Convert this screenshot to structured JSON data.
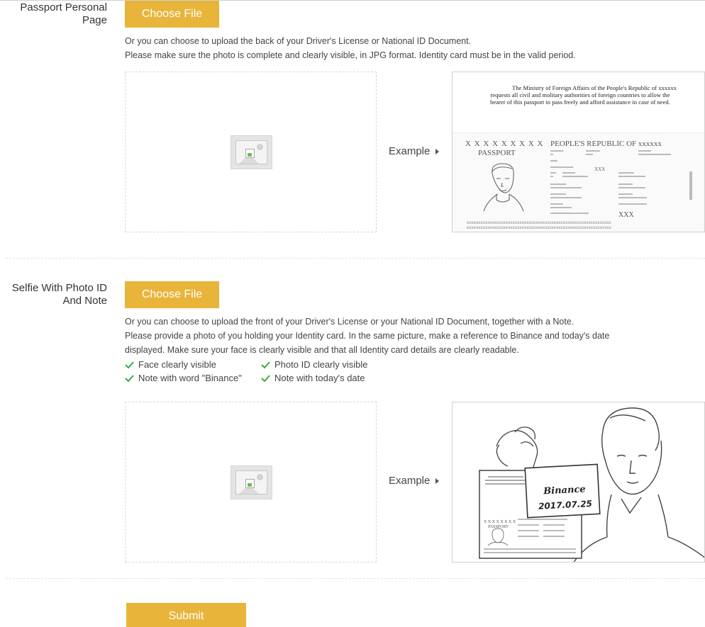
{
  "passport": {
    "label_line1": "Passport Personal",
    "label_line2": "Page",
    "choose_label": "Choose File",
    "hint_line1": "Or you can choose to upload the back of your Driver's License or National ID Document.",
    "hint_line2": "Please make sure the photo is complete and clearly visible, in JPG format. Identity card must be in the valid period.",
    "example_label": "Example",
    "sample": {
      "ministry_line1": "The Ministry of Foreign Affairs of the People's Republic of xxxxxx",
      "ministry_line2": "requests all civil and molitary authorities of foreign countries to allow the",
      "ministry_line3": "bearer of  this passport to pass freely and afford assistance in case of need.",
      "code_row": "X X X X X X X X X",
      "passport_word": "PASSPORT",
      "republic": "PEOPLE'S REPUBLIC OF xxxxxx",
      "field_a": "XXX",
      "field_b": "XXX",
      "side_code": "XXXXXXXXXX",
      "mrz": "XXXXXXXXXXXXXXXXXXXXXXXXXXXXXXXXXXXXXXXXXXXXXXXXXXXXXXXXXXXXXXX"
    }
  },
  "selfie": {
    "label_line1": "Selfie With Photo ID",
    "label_line2": "And Note",
    "choose_label": "Choose File",
    "hint_line1": "Or you can choose to upload the front of your Driver's License or your National ID Document, together with a Note.",
    "hint_line2": "Please provide a photo of you holding your Identity card. In the same picture, make a reference to Binance and today's date",
    "hint_line3": "displayed. Make sure your face is clearly visible and that all Identity card details are clearly readable.",
    "checks": [
      "Face clearly visible",
      "Photo ID clearly visible",
      "Note with word \"Binance\"",
      "Note with today's date"
    ],
    "example_label": "Example",
    "note_word": "Binance",
    "note_date": "2017.07.25",
    "mini_passport": "PASSPORT",
    "mini_code": "X X X X X X X X"
  },
  "submit_label": "Submit",
  "colors": {
    "accent": "#e8b53a",
    "check": "#3ea843"
  }
}
